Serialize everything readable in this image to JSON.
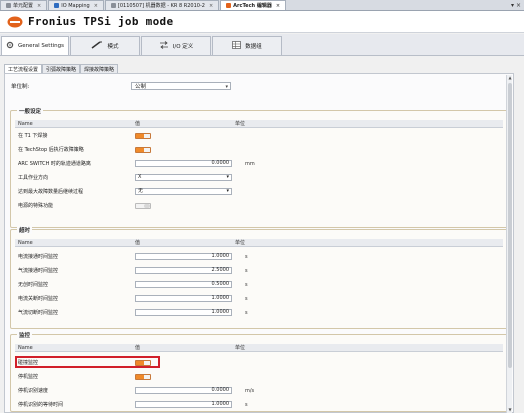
{
  "outer_tabs": [
    {
      "label": "单元配置",
      "icon": "cell-icon"
    },
    {
      "label": "IO Mapping",
      "icon": "io-icon"
    },
    {
      "label": "[0110507] 机器数据 - KR 8 R2010-2",
      "icon": "robot-icon"
    },
    {
      "label": "ArcTech 编辑器",
      "icon": "arctech-icon"
    }
  ],
  "banner": {
    "title": "Fronius TPSi job mode"
  },
  "main_tabs": [
    {
      "label": "General Settings"
    },
    {
      "label": "模式"
    },
    {
      "label": "I/O 定义"
    },
    {
      "label": "数据组"
    }
  ],
  "sub_tabs": [
    "工艺流程设置",
    "引弧故障策略",
    "焊接故障策略"
  ],
  "unit_system": {
    "label": "单位制:",
    "value": "公制"
  },
  "sections": {
    "general": {
      "title": "一般设定",
      "headers": [
        "Name",
        "值",
        "单位"
      ],
      "rows": [
        {
          "name": "在 T1 下焊接",
          "type": "toggle",
          "on": true
        },
        {
          "name": "在 TechStop 后执行故障策略",
          "type": "toggle",
          "on": true
        },
        {
          "name": "ARC SWITCH 时的轨迹通道路离",
          "type": "number",
          "value": "0.0000",
          "unit": "mm"
        },
        {
          "name": "工具作业方向",
          "type": "select",
          "value": "X"
        },
        {
          "name": "达到最大故障数量后继续过程",
          "type": "select",
          "value": "无"
        },
        {
          "name": "电源的特殊功能",
          "type": "toggle",
          "on": false
        }
      ]
    },
    "timing": {
      "title": "超时",
      "headers": [
        "Name",
        "值",
        "单位"
      ],
      "rows": [
        {
          "name": "电流接通时间监控",
          "value": "1.0000",
          "unit": "s"
        },
        {
          "name": "气流接通时间监控",
          "value": "2.5000",
          "unit": "s"
        },
        {
          "name": "无创时间监控",
          "value": "0.5000",
          "unit": "s"
        },
        {
          "name": "电流关断时间监控",
          "value": "1.0000",
          "unit": "s"
        },
        {
          "name": "气流切断时间监控",
          "value": "1.0000",
          "unit": "s"
        }
      ]
    },
    "monitor": {
      "title": "监控",
      "headers": [
        "Name",
        "值",
        "单位"
      ],
      "rows": [
        {
          "name": "碰撞监控",
          "type": "toggle",
          "on": true
        },
        {
          "name": "停机监控",
          "type": "toggle",
          "on": true
        },
        {
          "name": "停机识别速度",
          "type": "number",
          "value": "0.0000",
          "unit": "m/s"
        },
        {
          "name": "停机识别的等待时间",
          "type": "number",
          "value": "1.0000",
          "unit": "s"
        }
      ]
    }
  },
  "colors": {
    "accent_orange": "#f08a2a",
    "highlight_red": "#d11f2a"
  }
}
